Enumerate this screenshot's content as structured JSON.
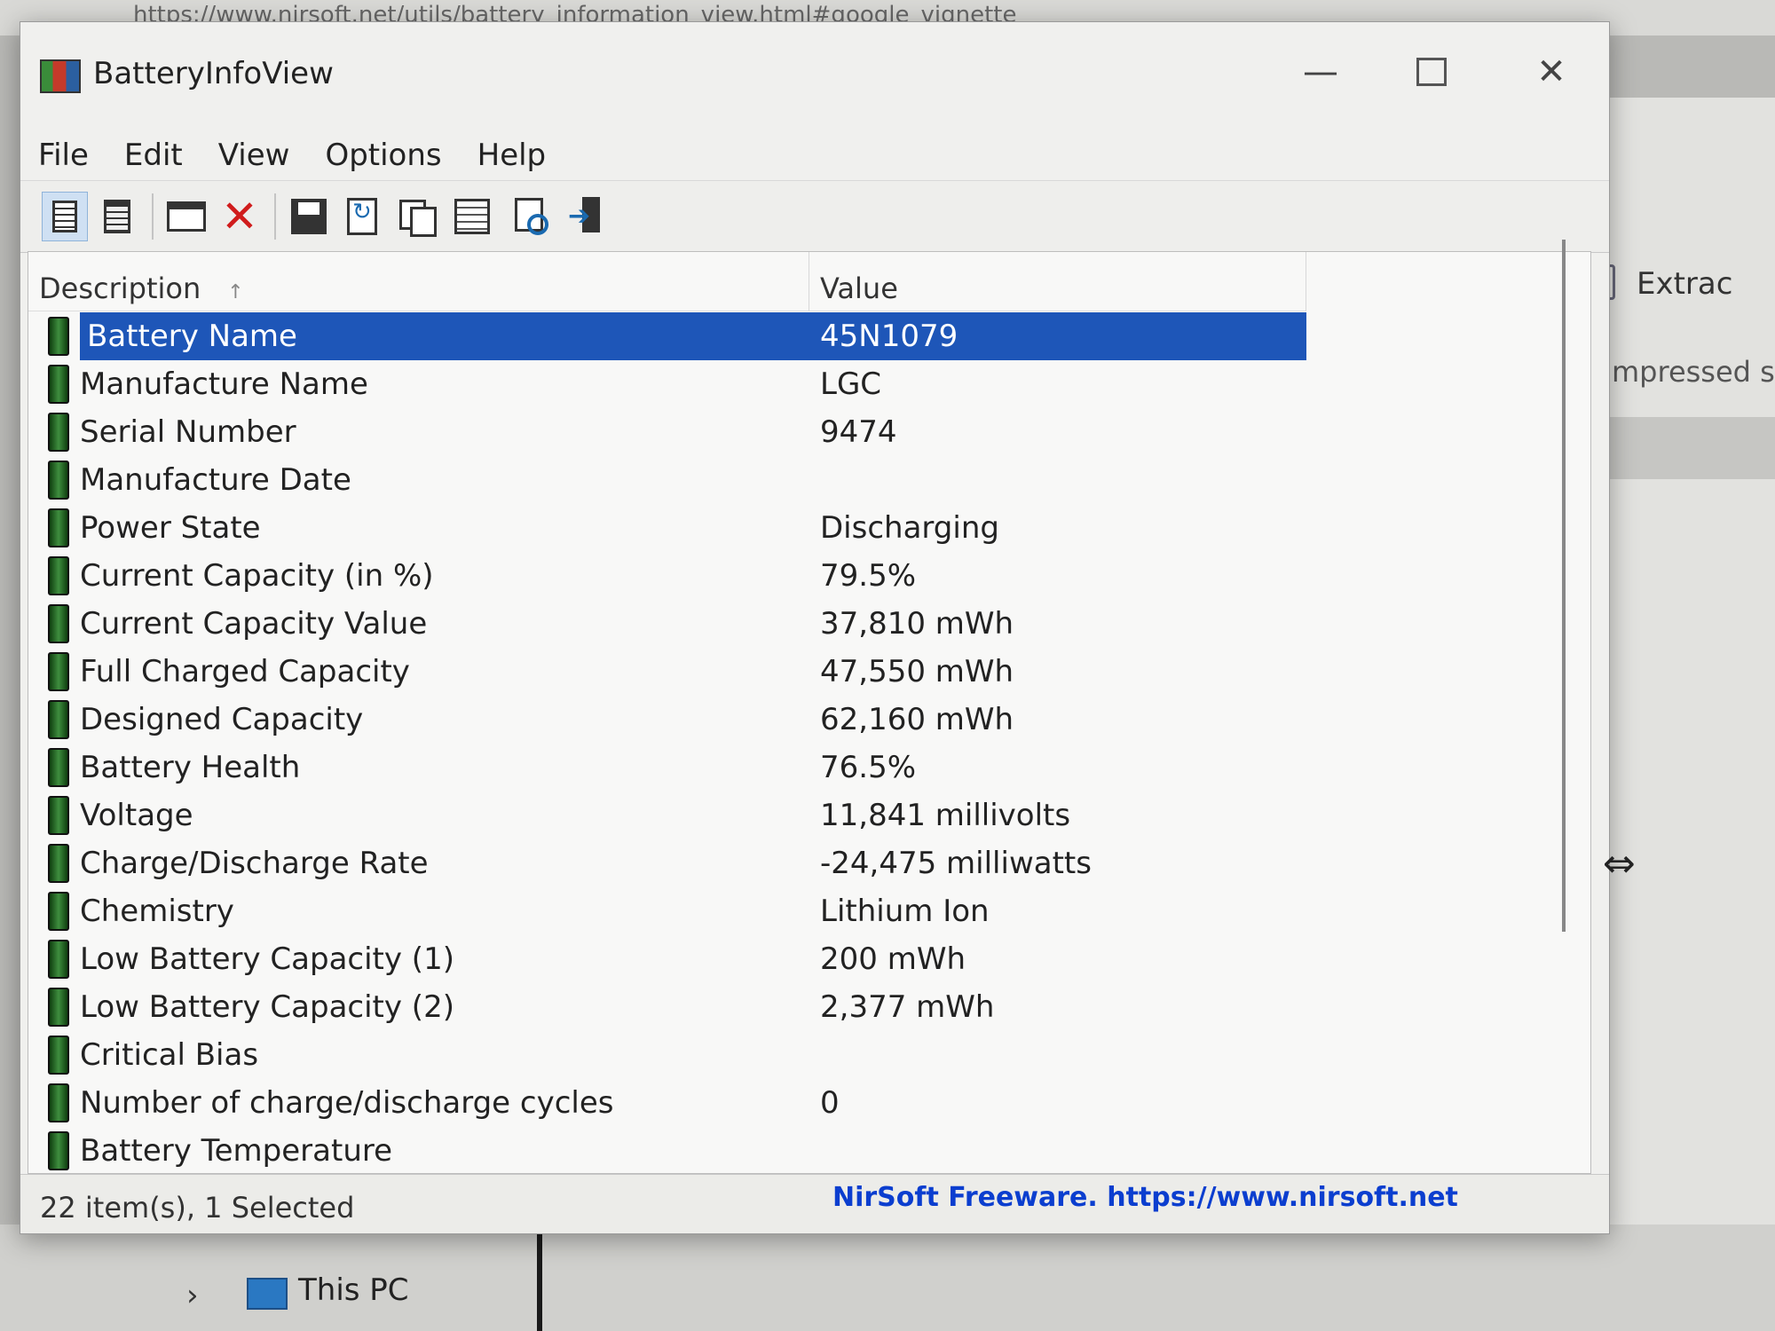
{
  "background": {
    "url_text": "https://www.nirsoft.net/utils/battery_information_view.html#google_vignette",
    "right_pane_action": "Extrac",
    "right_pane_column": "mpressed si",
    "nav_item": "This PC"
  },
  "window": {
    "title": "BatteryInfoView",
    "controls": {
      "minimize": "—",
      "maximize": "",
      "close": "✕"
    }
  },
  "menu": [
    "File",
    "Edit",
    "View",
    "Options",
    "Help"
  ],
  "toolbar": {
    "icons": [
      "properties-icon",
      "clipboard-icon",
      "window-icon",
      "delete-icon",
      "save-icon",
      "refresh-icon",
      "copy-icon",
      "html-report-icon",
      "find-icon",
      "exit-icon"
    ]
  },
  "list": {
    "columns": {
      "description": "Description",
      "value": "Value"
    },
    "sort_indicator": "↑",
    "rows": [
      {
        "description": "Battery Name",
        "value": "45N1079",
        "selected": true
      },
      {
        "description": "Manufacture Name",
        "value": "LGC"
      },
      {
        "description": "Serial Number",
        "value": "9474"
      },
      {
        "description": "Manufacture Date",
        "value": ""
      },
      {
        "description": "Power State",
        "value": "Discharging"
      },
      {
        "description": "Current Capacity (in %)",
        "value": "79.5%"
      },
      {
        "description": "Current Capacity Value",
        "value": "37,810 mWh"
      },
      {
        "description": "Full Charged Capacity",
        "value": "47,550 mWh"
      },
      {
        "description": "Designed Capacity",
        "value": "62,160 mWh"
      },
      {
        "description": "Battery Health",
        "value": "76.5%"
      },
      {
        "description": "Voltage",
        "value": "11,841 millivolts"
      },
      {
        "description": "Charge/Discharge Rate",
        "value": "-24,475 milliwatts"
      },
      {
        "description": "Chemistry",
        "value": "Lithium Ion"
      },
      {
        "description": "Low Battery Capacity (1)",
        "value": "200 mWh"
      },
      {
        "description": "Low Battery Capacity (2)",
        "value": "2,377 mWh"
      },
      {
        "description": "Critical Bias",
        "value": ""
      },
      {
        "description": "Number of charge/discharge cycles",
        "value": "0"
      },
      {
        "description": "Battery Temperature",
        "value": ""
      }
    ]
  },
  "status": {
    "count": "22 item(s), 1 Selected",
    "link": "NirSoft Freeware. https://www.nirsoft.net"
  },
  "colors": {
    "selection": "#1e56b8",
    "link": "#0b3ecf",
    "delete": "#d01c1c"
  }
}
